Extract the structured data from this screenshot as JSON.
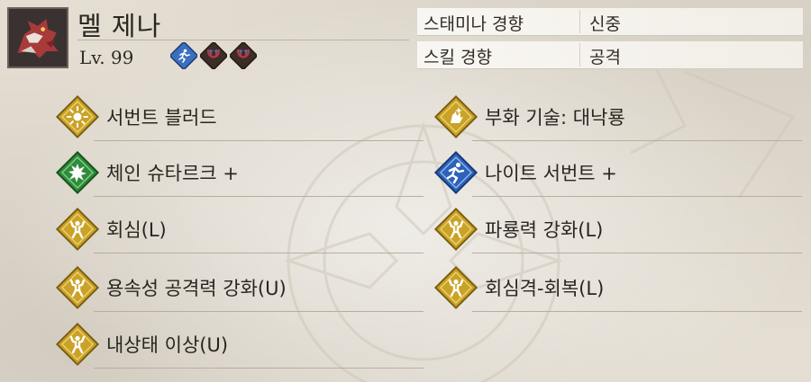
{
  "character": {
    "name": "멜 제나",
    "level": "Lv. 99",
    "portrait_icon": "dragon-portrait-icon",
    "badges": [
      {
        "icon": "runner-icon",
        "color": "#3a6fc1"
      },
      {
        "icon": "fang-icon",
        "color": "#3c2d26"
      },
      {
        "icon": "fang-icon",
        "color": "#3c2d26"
      }
    ]
  },
  "traits": [
    {
      "label": "스태미나 경향",
      "value": "신중"
    },
    {
      "label": "스킬 경향",
      "value": "공격"
    }
  ],
  "skills_left": [
    {
      "label": "서번트 블러드",
      "icon": "sun-burst-icon",
      "color": "gold"
    },
    {
      "label": "체인 슈타르크 +",
      "icon": "burst-icon",
      "color": "green"
    },
    {
      "label": "회심(L)",
      "icon": "strength-icon",
      "color": "gold"
    },
    {
      "label": "용속성 공격력 강화(U)",
      "icon": "strength-icon",
      "color": "gold"
    },
    {
      "label": "내상태 이상(U)",
      "icon": "strength-icon",
      "color": "gold"
    }
  ],
  "skills_right": [
    {
      "label": "부화 기술: 대낙룡",
      "icon": "claw-icon",
      "color": "gold"
    },
    {
      "label": "나이트 서번트 +",
      "icon": "runner-icon",
      "color": "blue"
    },
    {
      "label": "파룡력 강화(L)",
      "icon": "strength-icon",
      "color": "gold"
    },
    {
      "label": "회심격-회복(L)",
      "icon": "strength-icon",
      "color": "gold"
    }
  ],
  "colors": {
    "gold": "#c9a227",
    "gold_light": "#e6c858",
    "green": "#2f8c3a",
    "blue": "#2e62b8",
    "text": "#2a2520",
    "background": "#e3ddd2"
  }
}
